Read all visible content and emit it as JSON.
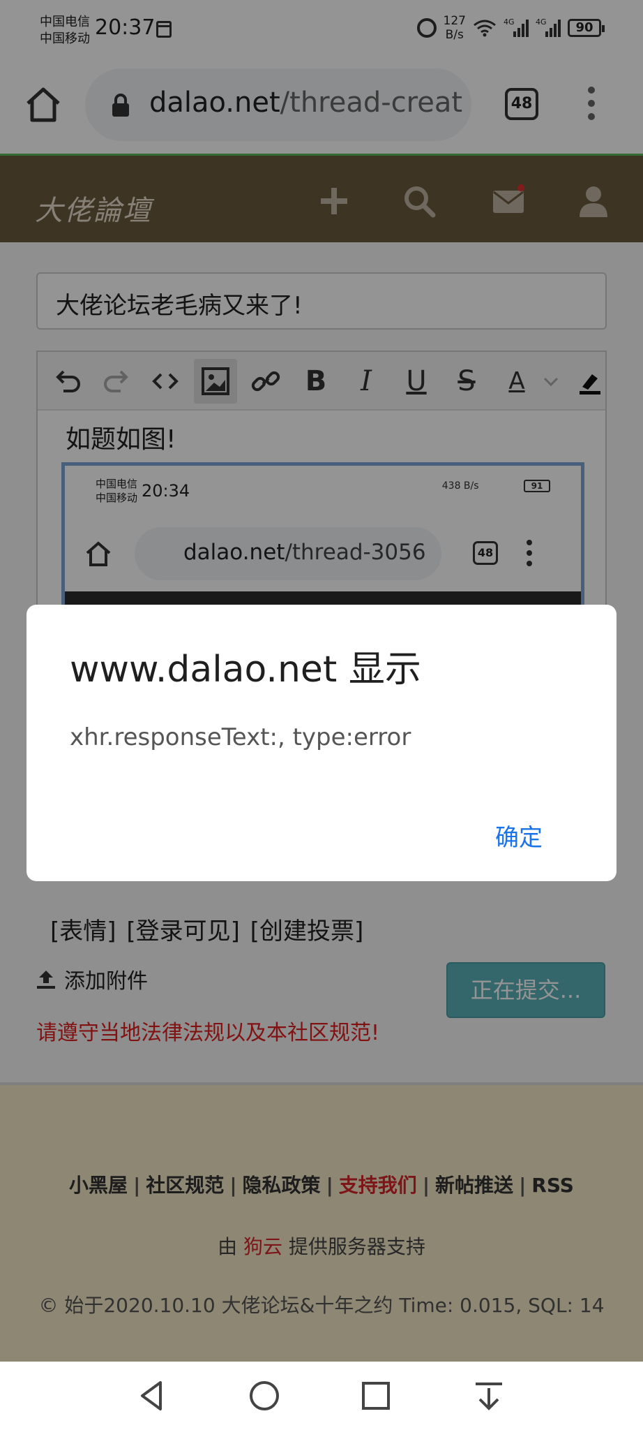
{
  "status_bar": {
    "carrier_1": "中国电信",
    "carrier_2": "中国移动",
    "time": "20:37",
    "speed_value": "127",
    "speed_unit": "B/s",
    "signal_tag_1": "4G",
    "signal_tag_2": "4G",
    "battery": "90"
  },
  "browser": {
    "url_domain": "dalao.net",
    "url_path": "/thread-creat",
    "tab_count": "48"
  },
  "site": {
    "logo": "大佬論壇"
  },
  "form": {
    "title_value": "大佬论坛老毛病又来了!",
    "editor_text": "如题如图!",
    "extra_links": "[表情] [登录可见] [创建投票]",
    "attach_label": "添加附件",
    "submit_label": "正在提交...",
    "notice": "请遵守当地法律法规以及本社区规范!"
  },
  "embedded_screenshot": {
    "carrier_1": "中国电信",
    "carrier_2": "中国移动",
    "time": "20:34",
    "speed": "438 B/s",
    "battery": "91",
    "url_domain": "dalao.net",
    "url_path": "/thread-3056",
    "tab_count": "48"
  },
  "footer": {
    "links": [
      {
        "label": "小黑屋"
      },
      {
        "label": "社区规范"
      },
      {
        "label": "隐私政策"
      },
      {
        "label": "支持我们",
        "highlight": true
      },
      {
        "label": "新帖推送"
      },
      {
        "label": "RSS"
      }
    ],
    "support_prefix": "由",
    "support_provider": "狗云",
    "support_suffix": "提供服务器支持",
    "copyright": "© 始于2020.10.10 大佬论坛&十年之约 Time: 0.015, SQL: 14"
  },
  "dialog": {
    "title": "www.dalao.net 显示",
    "message": "xhr.responseText:, type:error",
    "ok_label": "确定"
  },
  "colors": {
    "header_bg": "#6c5a3f",
    "accent_button": "#5ab1b9",
    "notice_red": "#e02020",
    "dialog_button": "#1a73e8"
  }
}
